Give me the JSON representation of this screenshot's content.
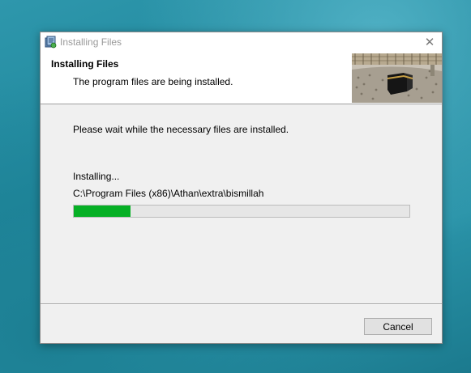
{
  "window": {
    "title": "Installing Files",
    "close_icon": "close-icon",
    "app_icon": "installer-icon"
  },
  "header": {
    "title": "Installing Files",
    "subtitle": "The program files are being installed.",
    "image": "kaaba-photo"
  },
  "body": {
    "message": "Please wait while the necessary files are installed.",
    "status": "Installing...",
    "current_path": "C:\\Program Files (x86)\\Athan\\extra\\bismillah",
    "progress_fraction": 0.17,
    "progress_color": "#06b025"
  },
  "footer": {
    "cancel_label": "Cancel"
  }
}
